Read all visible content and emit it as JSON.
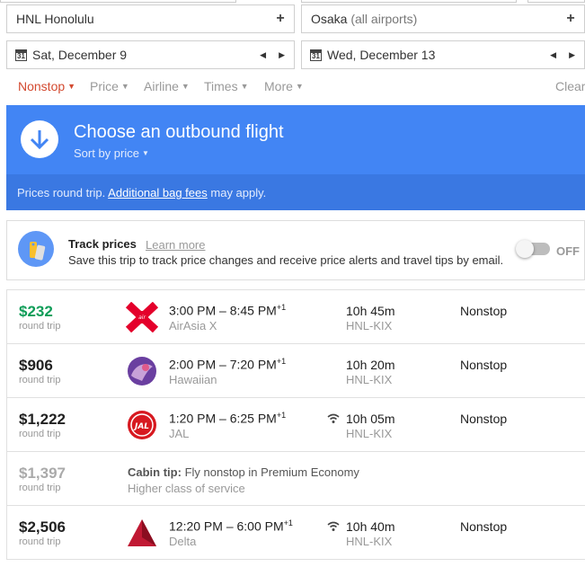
{
  "search": {
    "origin": {
      "code": "HNL",
      "name": "Honolulu"
    },
    "destination": {
      "name": "Osaka",
      "qualifier": "(all airports)"
    },
    "depart_date": "Sat, December 9",
    "return_date": "Wed, December 13",
    "calendar_day": "31",
    "add_symbol": "+",
    "prev_symbol": "◀",
    "next_symbol": "▶"
  },
  "filters": {
    "items": [
      {
        "label": "Nonstop",
        "active": true
      },
      {
        "label": "Price",
        "active": false
      },
      {
        "label": "Airline",
        "active": false
      },
      {
        "label": "Times",
        "active": false
      },
      {
        "label": "More",
        "active": false
      }
    ],
    "caret": "▼",
    "clear_label": "Clear"
  },
  "banner": {
    "title": "Choose an outbound flight",
    "sort_label": "Sort by price",
    "caret": "▼",
    "notice_prefix": "Prices round trip.",
    "notice_link": "Additional bag fees",
    "notice_suffix": "may apply.",
    "color": "#4285f4"
  },
  "track_prices": {
    "title": "Track prices",
    "learn_more": "Learn more",
    "description": "Save this trip to track price changes and receive price alerts and travel tips by email.",
    "toggle_state": "OFF"
  },
  "flights": [
    {
      "price": "$232",
      "price_note": "round trip",
      "price_style": "green",
      "logo": "airasia-logo",
      "times": "3:00 PM – 8:45 PM",
      "day_offset": "+1",
      "airline": "AirAsia X",
      "wifi": false,
      "duration": "10h 45m",
      "route": "HNL-KIX",
      "stops": "Nonstop"
    },
    {
      "price": "$906",
      "price_note": "round trip",
      "price_style": "normal",
      "logo": "hawaiian-logo",
      "times": "2:00 PM – 7:20 PM",
      "day_offset": "+1",
      "airline": "Hawaiian",
      "wifi": false,
      "duration": "10h 20m",
      "route": "HNL-KIX",
      "stops": "Nonstop"
    },
    {
      "price": "$1,222",
      "price_note": "round trip",
      "price_style": "normal",
      "logo": "jal-logo",
      "times": "1:20 PM – 6:25 PM",
      "day_offset": "+1",
      "airline": "JAL",
      "wifi": true,
      "duration": "10h 05m",
      "route": "HNL-KIX",
      "stops": "Nonstop"
    }
  ],
  "cabin_tip": {
    "price": "$1,397",
    "price_note": "round trip",
    "label": "Cabin tip:",
    "text": "Fly nonstop in Premium Economy",
    "subtext": "Higher class of service"
  },
  "flights_after_tip": [
    {
      "price": "$2,506",
      "price_note": "round trip",
      "price_style": "normal",
      "logo": "delta-logo",
      "times": "12:20 PM – 6:00 PM",
      "day_offset": "+1",
      "airline": "Delta",
      "wifi": true,
      "duration": "10h 40m",
      "route": "HNL-KIX",
      "stops": "Nonstop"
    }
  ],
  "colors": {
    "accent_red": "#d34a30",
    "price_green": "#0f9d58",
    "banner_blue": "#4285f4"
  }
}
